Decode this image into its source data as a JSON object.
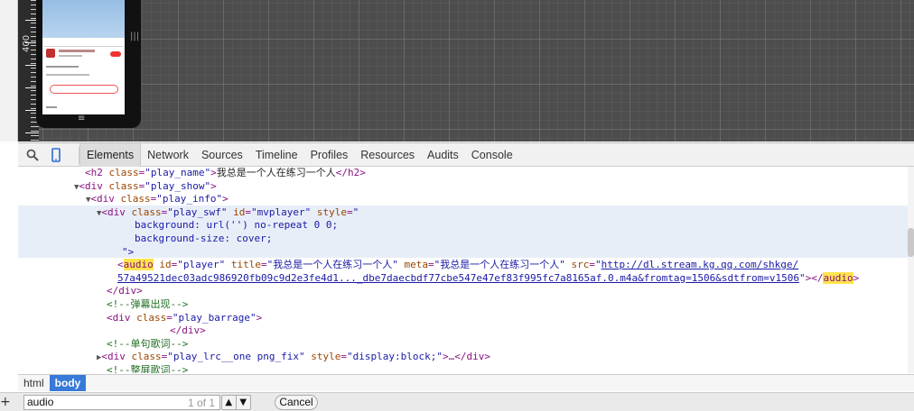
{
  "viewport": {
    "ruler_label": "400"
  },
  "toolbar": {
    "search_icon": "magnifier-icon",
    "device_icon": "mobile-device-icon",
    "tabs": [
      "Elements",
      "Network",
      "Sources",
      "Timeline",
      "Profiles",
      "Resources",
      "Audits",
      "Console"
    ],
    "active_tab": "Elements"
  },
  "code": {
    "l1_open": "<h2 ",
    "l1_attr": "class",
    "l1_val": "\"play_name\"",
    "l1_text": "我总是一个人在练习一个人",
    "l1_close": "</h2>",
    "l2_open": "<div ",
    "l2_attr": "class",
    "l2_val": "\"play_show\"",
    "l2_end": ">",
    "l3_open": "<div ",
    "l3_attr": "class",
    "l3_val": "\"play_info\"",
    "l3_end": ">",
    "l4_open": "<div ",
    "l4_attr1": "class",
    "l4_val1": "\"play_swf\"",
    "l4_attr2": "id",
    "l4_val2": "\"mvplayer\"",
    "l4_attr3": "style",
    "l4_val3": "\"",
    "l5": "background: url('') no-repeat 0 0;",
    "l6": "background-size: cover;",
    "l7": "\">",
    "l8_lt": "<",
    "l8_tag": "audio",
    "l8_attr1": "id",
    "l8_val1": "\"player\"",
    "l8_attr2": "title",
    "l8_val2": "\"我总是一个人在练习一个人\"",
    "l8_attr3": "meta",
    "l8_val3": "\"我总是一个人在练习一个人\"",
    "l8_attr4": "src",
    "l8_q": "\"",
    "l8_link1": "http://dl.stream.kg.qq.com/shkge/",
    "l9_link2": "57a49521dec03adc986920fb09c9d2e3fe4d1..._dbe7daecbdf77cbe547e47ef83f995fc7a8165af.0.m4a&fromtag=1506&sdtfrom=v1506",
    "l9_q": "\"",
    "l9_close_a": "></",
    "l9_tag": "audio",
    "l9_close_b": ">",
    "l10": "</div>",
    "l11": "<!--弹幕出现-->",
    "l12_open": "<div ",
    "l12_attr": "class",
    "l12_val": "\"play_barrage\"",
    "l12_end": ">",
    "l13": "</div>",
    "l14": "<!--单句歌词-->",
    "l15_open": "<div ",
    "l15_attr1": "class",
    "l15_val1": "\"play_lrc__one png_fix\"",
    "l15_attr2": "style",
    "l15_val2": "\"display:block;\"",
    "l15_end": ">…</div>",
    "l16": "<!--整屏歌词-->"
  },
  "breadcrumb": [
    "html",
    "body"
  ],
  "search": {
    "value": "audio",
    "count": "1 of 1",
    "prev": "▲",
    "next": "▼",
    "cancel_label": "Cancel"
  },
  "colors": {
    "highlight": "#ffe44d",
    "selected_crumb": "#3879d9"
  }
}
